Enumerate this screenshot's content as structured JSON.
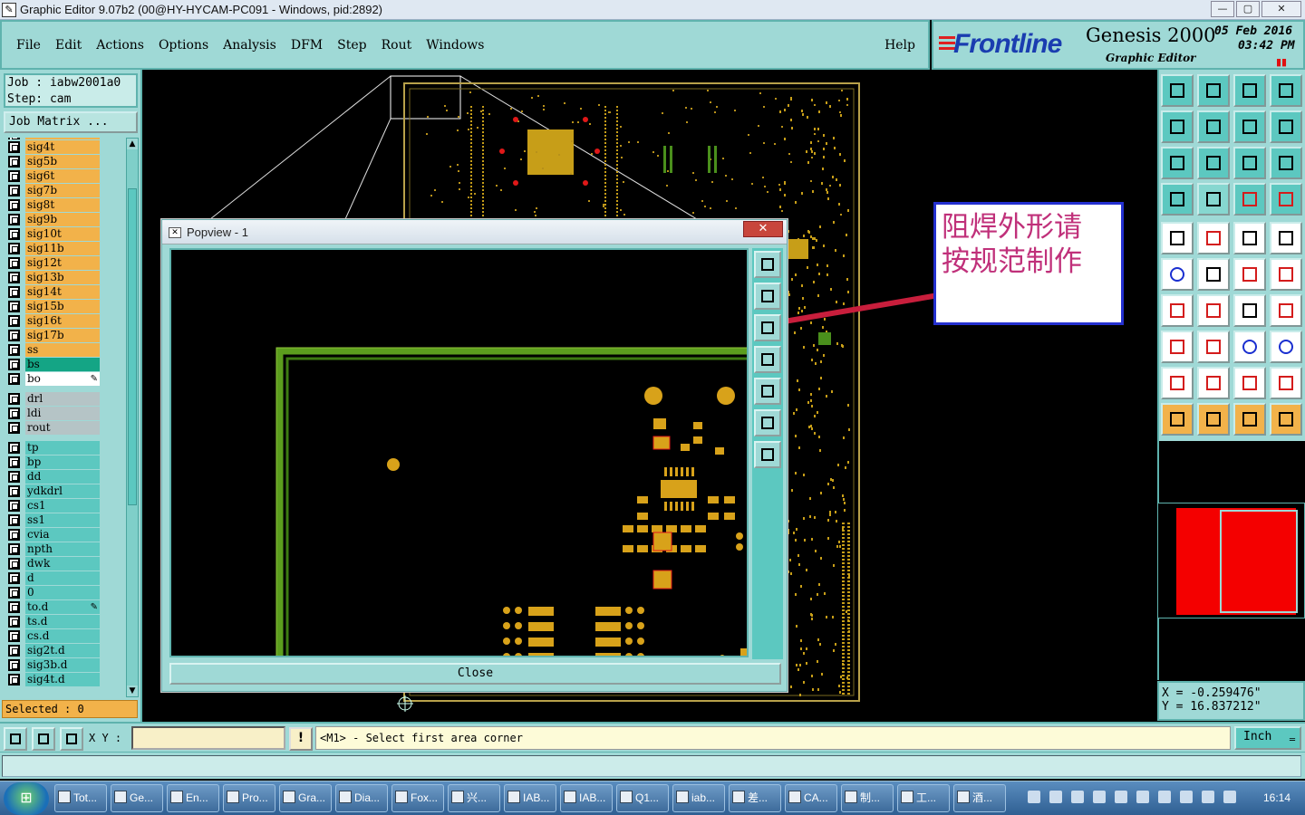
{
  "window": {
    "title": "Graphic Editor 9.07b2 (00@HY-HYCAM-PC091 - Windows, pid:2892)",
    "minimize_icon": "minimize-icon",
    "maximize_icon": "maximize-icon",
    "close_icon": "close-icon"
  },
  "menu": {
    "items": [
      "File",
      "Edit",
      "Actions",
      "Options",
      "Analysis",
      "DFM",
      "Step",
      "Rout",
      "Windows"
    ],
    "help": "Help"
  },
  "brand": {
    "logo": "Frontline",
    "product": "Genesis 2000",
    "subtitle": "Graphic Editor",
    "date": "05 Feb 2016",
    "time": "03:42  PM"
  },
  "job": {
    "job_line": "Job  : iabw2001a0",
    "step_line": "Step: cam",
    "matrix_button": "Job Matrix ..."
  },
  "layers": {
    "board": [
      "sig4t",
      "sig5b",
      "sig6t",
      "sig7b",
      "sig8t",
      "sig9b",
      "sig10t",
      "sig11b",
      "sig12t",
      "sig13b",
      "sig14t",
      "sig15b",
      "sig16t",
      "sig17b",
      "ss",
      "bs",
      "bo"
    ],
    "drill": [
      "drl",
      "ldi",
      "rout"
    ],
    "misc": [
      "tp",
      "bp",
      "dd",
      "ydkdrl",
      "cs1",
      "ss1",
      "cvia",
      "npth",
      "dwk",
      "d",
      "0",
      "to.d",
      "ts.d",
      "cs.d",
      "sig2t.d",
      "sig3b.d",
      "sig4t.d"
    ]
  },
  "selected": "Selected : 0",
  "popview": {
    "title": "Popview - 1",
    "close_x": "✕",
    "close_button": "Close"
  },
  "annotation": {
    "line1": "阻焊外形请",
    "line2": "按规范制作"
  },
  "coords": {
    "x": "X  = -0.259476\"",
    "y": "Y  = 16.837212\""
  },
  "command": {
    "xy_label": "X Y :",
    "xy_value": "",
    "warn_glyph": "!",
    "prompt": "<M1> - Select first area corner",
    "units": "Inch"
  },
  "taskbar": {
    "start_label": "⊞",
    "tasks": [
      "Tot...",
      "Ge...",
      "En...",
      "Pro...",
      "Gra...",
      "Dia...",
      "Fox...",
      "兴...",
      "IAB...",
      "IAB...",
      "Q1...",
      "iab...",
      "差...",
      "CA...",
      "制...",
      "工...",
      "酒..."
    ],
    "clock": "16:14"
  },
  "colors": {
    "panel": "#9fd9d6",
    "signal_layer": "#f2b24a",
    "bs_layer": "#14a585",
    "pcb_copper": "#d8a21a",
    "pcb_outline": "#5c9e1e",
    "callout_text": "#c0307a",
    "callout_border": "#2430d0",
    "arrow": "#c81e3c"
  }
}
